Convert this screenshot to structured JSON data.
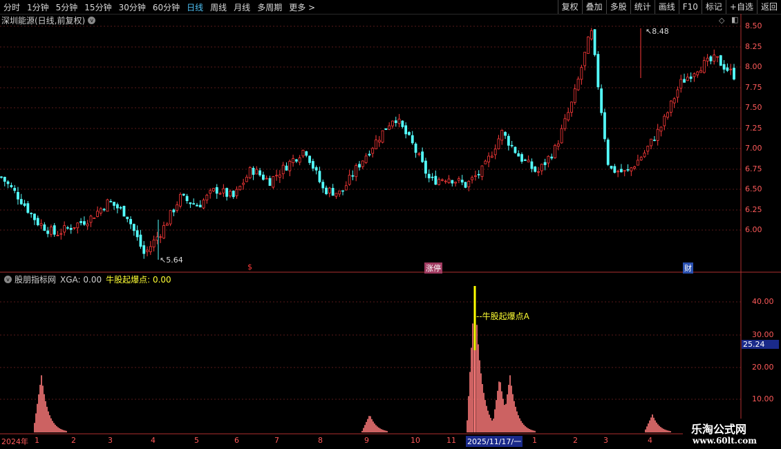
{
  "toolbar": {
    "periods": [
      "分时",
      "1分钟",
      "5分钟",
      "15分钟",
      "30分钟",
      "60分钟",
      "日线",
      "周线",
      "月线",
      "多周期",
      "更多 >"
    ],
    "active": "日线",
    "right_items": [
      "复权",
      "叠加",
      "多股",
      "统计",
      "画线",
      "F10",
      "标记",
      "+自选",
      "返回"
    ]
  },
  "title": {
    "text": "深圳能源(日线,前复权)",
    "dropdown": "v"
  },
  "price_axis": {
    "labels": [
      "8.50",
      "8.25",
      "8.00",
      "7.75",
      "7.50",
      "7.25",
      "7.00",
      "6.75",
      "6.50",
      "6.25",
      "6.00"
    ],
    "ylim": [
      5.64,
      8.48
    ]
  },
  "annotations": {
    "high": "8.48",
    "low": "5.64",
    "high_marker": "↖",
    "low_marker": "↖"
  },
  "event_tags": {
    "s": "$",
    "zhangting": "涨停",
    "cai": "财"
  },
  "indicator": {
    "name": "股朋指标网",
    "xga": "XGA: 0.00",
    "nuggu": "牛股起爆点: 0.00",
    "signal_label": "--牛股起爆点A",
    "current": "25.24"
  },
  "ind_axis": {
    "labels": [
      "40.00",
      "30.00",
      "20.00",
      "10.00"
    ]
  },
  "dates": [
    "2024年",
    "1",
    "2",
    "3",
    "4",
    "5",
    "6",
    "7",
    "8",
    "9",
    "10",
    "11",
    "2025/11/17/一",
    "1",
    "2",
    "3",
    "4"
  ],
  "watermark": {
    "line1": "乐淘公式网",
    "line2": "www.60lt.com"
  },
  "colors": {
    "up": "#ff3a3a",
    "down": "#54ffff",
    "bar": "#ff7b7b",
    "signal": "#ffff00"
  },
  "chart_data": {
    "type": "candlestick",
    "price_range": [
      5.64,
      8.48
    ],
    "close_anchors": [
      6.65,
      6.4,
      6.1,
      5.95,
      6.05,
      6.15,
      6.35,
      6.2,
      5.7,
      6.0,
      6.4,
      6.3,
      6.5,
      6.4,
      6.75,
      6.6,
      6.8,
      7.0,
      6.5,
      6.45,
      6.8,
      7.1,
      7.4,
      7.05,
      6.6,
      6.65,
      6.55,
      6.75,
      7.2,
      6.9,
      6.7,
      7.0,
      7.6,
      8.45,
      6.75,
      6.7,
      6.95,
      7.3,
      7.8,
      8.0,
      8.1,
      7.9
    ],
    "indicator_peaks": [
      {
        "x": 60,
        "value": 17.5
      },
      {
        "x": 535,
        "value": 5.5
      },
      {
        "x": 687,
        "value": 44.5
      },
      {
        "x": 723,
        "value": 17.0
      },
      {
        "x": 738,
        "value": 17.5
      },
      {
        "x": 944,
        "value": 5.5
      }
    ],
    "indicator_ylim": [
      0,
      45
    ]
  }
}
